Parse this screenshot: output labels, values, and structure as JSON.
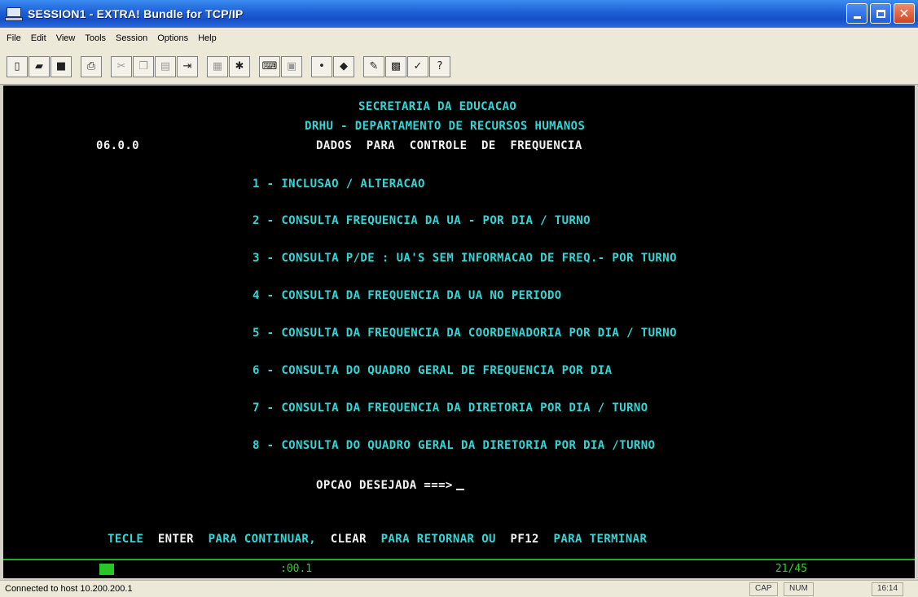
{
  "window": {
    "title": "SESSION1 - EXTRA! Bundle for TCP/IP",
    "buttons": [
      "minimize",
      "maximize",
      "close"
    ]
  },
  "menu": [
    "File",
    "Edit",
    "View",
    "Tools",
    "Session",
    "Options",
    "Help"
  ],
  "toolbar": {
    "groups": [
      [
        {
          "icon": "new-document-icon",
          "glyph": "▯",
          "enabled": true
        },
        {
          "icon": "open-folder-icon",
          "glyph": "▰",
          "enabled": true
        },
        {
          "icon": "save-icon",
          "glyph": "■",
          "enabled": true
        }
      ],
      [
        {
          "icon": "print-icon",
          "glyph": "⎙",
          "enabled": true
        }
      ],
      [
        {
          "icon": "cut-icon",
          "glyph": "✂",
          "enabled": false
        },
        {
          "icon": "copy-icon",
          "glyph": "❐",
          "enabled": false
        },
        {
          "icon": "paste-icon",
          "glyph": "▤",
          "enabled": false
        },
        {
          "icon": "macro-icon",
          "glyph": "⇥",
          "enabled": true
        }
      ],
      [
        {
          "icon": "transfer-icon",
          "glyph": "▦",
          "enabled": false
        },
        {
          "icon": "tools-icon",
          "glyph": "✱",
          "enabled": true
        }
      ],
      [
        {
          "icon": "keyboard-map-icon",
          "glyph": "⌨",
          "enabled": true
        },
        {
          "icon": "display-icon",
          "glyph": "▣",
          "enabled": false
        }
      ],
      [
        {
          "icon": "connect-icon",
          "glyph": "•",
          "enabled": true
        },
        {
          "icon": "session-icon",
          "glyph": "◆",
          "enabled": true
        }
      ],
      [
        {
          "icon": "edit-settings-icon",
          "glyph": "✎",
          "enabled": true
        },
        {
          "icon": "screen-settings-icon",
          "glyph": "▩",
          "enabled": true
        },
        {
          "icon": "check-settings-icon",
          "glyph": "✓",
          "enabled": true
        },
        {
          "icon": "context-help-icon",
          "glyph": "?",
          "enabled": true
        }
      ]
    ]
  },
  "terminal": {
    "header_line1": "SECRETARIA DA EDUCACAO",
    "header_line2": "DRHU - DEPARTAMENTO DE RECURSOS HUMANOS",
    "screen_code": "06.0.0",
    "header_line3": "DADOS  PARA  CONTROLE  DE  FREQUENCIA",
    "options": [
      "1 - INCLUSAO / ALTERACAO",
      "2 - CONSULTA FREQUENCIA DA UA - POR DIA / TURNO",
      "3 - CONSULTA P/DE : UA'S SEM INFORMACAO DE FREQ.- POR TURNO",
      "4 - CONSULTA DA FREQUENCIA DA UA NO PERIODO",
      "5 - CONSULTA DA FREQUENCIA DA COORDENADORIA POR DIA / TURNO",
      "6 - CONSULTA DO QUADRO GERAL DE FREQUENCIA POR DIA",
      "7 - CONSULTA DA FREQUENCIA DA DIRETORIA POR DIA / TURNO",
      "8 - CONSULTA DO QUADRO GERAL DA DIRETORIA POR DIA /TURNO"
    ],
    "prompt": "OPCAO DESEJADA ===>",
    "footer": {
      "p1": "TECLE",
      "k1": "ENTER",
      "p2": "PARA CONTINUAR,",
      "k2": "CLEAR",
      "p3": "PARA RETORNAR OU",
      "k3": "PF12",
      "p4": "PARA TERMINAR"
    },
    "colors": {
      "text": "#33d6d6",
      "highlight": "#f2f2f2",
      "background": "#000000"
    }
  },
  "oia": {
    "center": ":00.1",
    "position": "21/45"
  },
  "statusbar": {
    "message": "Connected to host 10.200.200.1",
    "cap": "CAP",
    "num": "NUM",
    "time": "16:14"
  }
}
